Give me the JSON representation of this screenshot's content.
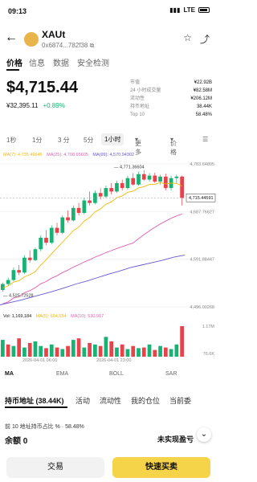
{
  "status": {
    "time": "09:13",
    "network": "LTE",
    "battery": "battery"
  },
  "header": {
    "token_name": "XAUt",
    "address": "0x6874...782f38",
    "icons": [
      "back-arrow-icon",
      "star-icon",
      "share-icon"
    ]
  },
  "tabs": [
    "价格",
    "信息",
    "数据",
    "安全检测"
  ],
  "price": {
    "main": "$4,715.44",
    "sub_value": "¥32,395.11",
    "change": "+0.89%"
  },
  "stats": [
    {
      "label": "市值",
      "value": "¥22.92B"
    },
    {
      "label": "24 小时成交量",
      "value": "¥82.58M"
    },
    {
      "label": "流动性",
      "value": "¥206.12M"
    },
    {
      "label": "持币地址",
      "value": "38.44K"
    },
    {
      "label": "Top 10",
      "value": "58.48%"
    }
  ],
  "intervals": [
    "1秒",
    "1分",
    "3 分",
    "5分",
    "1小时",
    "更多",
    "价格"
  ],
  "ma_legend": {
    "ma7": "MA(7): 4,735.49646",
    "ma25": "MA(25): 4,708.65605",
    "ma99": "MA(99): 4,570.94302"
  },
  "chart_data": {
    "type": "candlestick",
    "y_ticks": [
      "4,783.64805",
      "4,687.76627",
      "4,591.88447",
      "4,496.00268"
    ],
    "high_label": "4,771.36604",
    "low_label": "4,525.72528",
    "current_label": "4,715.44591",
    "candles": [
      [
        4530,
        4545,
        4526,
        4542
      ],
      [
        4542,
        4555,
        4538,
        4550
      ],
      [
        4550,
        4575,
        4548,
        4570
      ],
      [
        4570,
        4580,
        4560,
        4565
      ],
      [
        4565,
        4600,
        4562,
        4595
      ],
      [
        4595,
        4610,
        4585,
        4590
      ],
      [
        4590,
        4615,
        4588,
        4612
      ],
      [
        4612,
        4640,
        4608,
        4635
      ],
      [
        4635,
        4650,
        4620,
        4625
      ],
      [
        4625,
        4660,
        4622,
        4655
      ],
      [
        4655,
        4665,
        4640,
        4645
      ],
      [
        4645,
        4680,
        4642,
        4676
      ],
      [
        4676,
        4690,
        4665,
        4670
      ],
      [
        4670,
        4700,
        4668,
        4695
      ],
      [
        4695,
        4705,
        4680,
        4685
      ],
      [
        4685,
        4715,
        4682,
        4710
      ],
      [
        4710,
        4728,
        4700,
        4705
      ],
      [
        4705,
        4730,
        4702,
        4725
      ],
      [
        4725,
        4735,
        4712,
        4718
      ],
      [
        4718,
        4740,
        4715,
        4735
      ],
      [
        4735,
        4745,
        4722,
        4728
      ],
      [
        4728,
        4750,
        4725,
        4745
      ],
      [
        4745,
        4752,
        4730,
        4735
      ],
      [
        4735,
        4760,
        4732,
        4755
      ],
      [
        4755,
        4765,
        4740,
        4742
      ],
      [
        4742,
        4768,
        4740,
        4763
      ],
      [
        4763,
        4771,
        4750,
        4752
      ],
      [
        4752,
        4765,
        4748,
        4760
      ],
      [
        4760,
        4766,
        4745,
        4748
      ],
      [
        4748,
        4762,
        4742,
        4758
      ],
      [
        4758,
        4764,
        4730,
        4735
      ],
      [
        4735,
        4760,
        4730,
        4755
      ],
      [
        4755,
        4762,
        4745,
        4758
      ],
      [
        4758,
        4760,
        4700,
        4715
      ]
    ],
    "ma99": [
      4500,
      4505,
      4510,
      4516,
      4522,
      4528,
      4535,
      4542,
      4548,
      4555,
      4562,
      4568,
      4575,
      4580,
      4585,
      4590,
      4596,
      4600
    ]
  },
  "volume": {
    "legend": {
      "vol": "Vol: 1,169,184",
      "ma5": "MA(5): 604,654",
      "ma10": "MA(10): 530,917"
    },
    "axis_top": "1.17M",
    "axis_bottom": "76.6K",
    "bars": [
      0.55,
      0.4,
      0.35,
      0.6,
      0.3,
      0.45,
      0.5,
      0.35,
      0.28,
      0.4,
      0.3,
      0.25,
      0.35,
      0.55,
      0.6,
      0.3,
      0.45,
      0.4,
      0.35,
      0.65,
      0.5,
      0.3,
      0.4,
      0.25,
      0.35,
      0.28,
      0.3,
      0.4,
      0.22,
      0.35,
      0.3,
      0.25,
      0.4,
      1.0
    ],
    "dir": [
      1,
      0,
      1,
      0,
      1,
      0,
      1,
      1,
      0,
      1,
      0,
      1,
      0,
      1,
      0,
      1,
      0,
      1,
      0,
      1,
      0,
      1,
      0,
      1,
      0,
      1,
      0,
      1,
      0,
      1,
      0,
      1,
      1,
      0
    ]
  },
  "time_axis": [
    "2026-04-01 06:00",
    "2026-04-01 23:00"
  ],
  "indicators": [
    "MA",
    "EMA",
    "BOLL",
    "SAR"
  ],
  "subtabs": [
    "持币地址 (38.44K)",
    "活动",
    "流动性",
    "我的仓位",
    "当前委"
  ],
  "holder_line": "前 10 地址持币占比 % · 58.48%",
  "balance": "余额 0",
  "unrealized": "未实现盈亏",
  "buttons": {
    "trade": "交易",
    "buy": "快速买卖"
  },
  "colors": {
    "up": "#18b374",
    "down": "#e8424a",
    "ma7": "#f0b90b",
    "ma25": "#e05fb1",
    "ma99": "#6a56d6",
    "accent": "#f5d44a"
  }
}
